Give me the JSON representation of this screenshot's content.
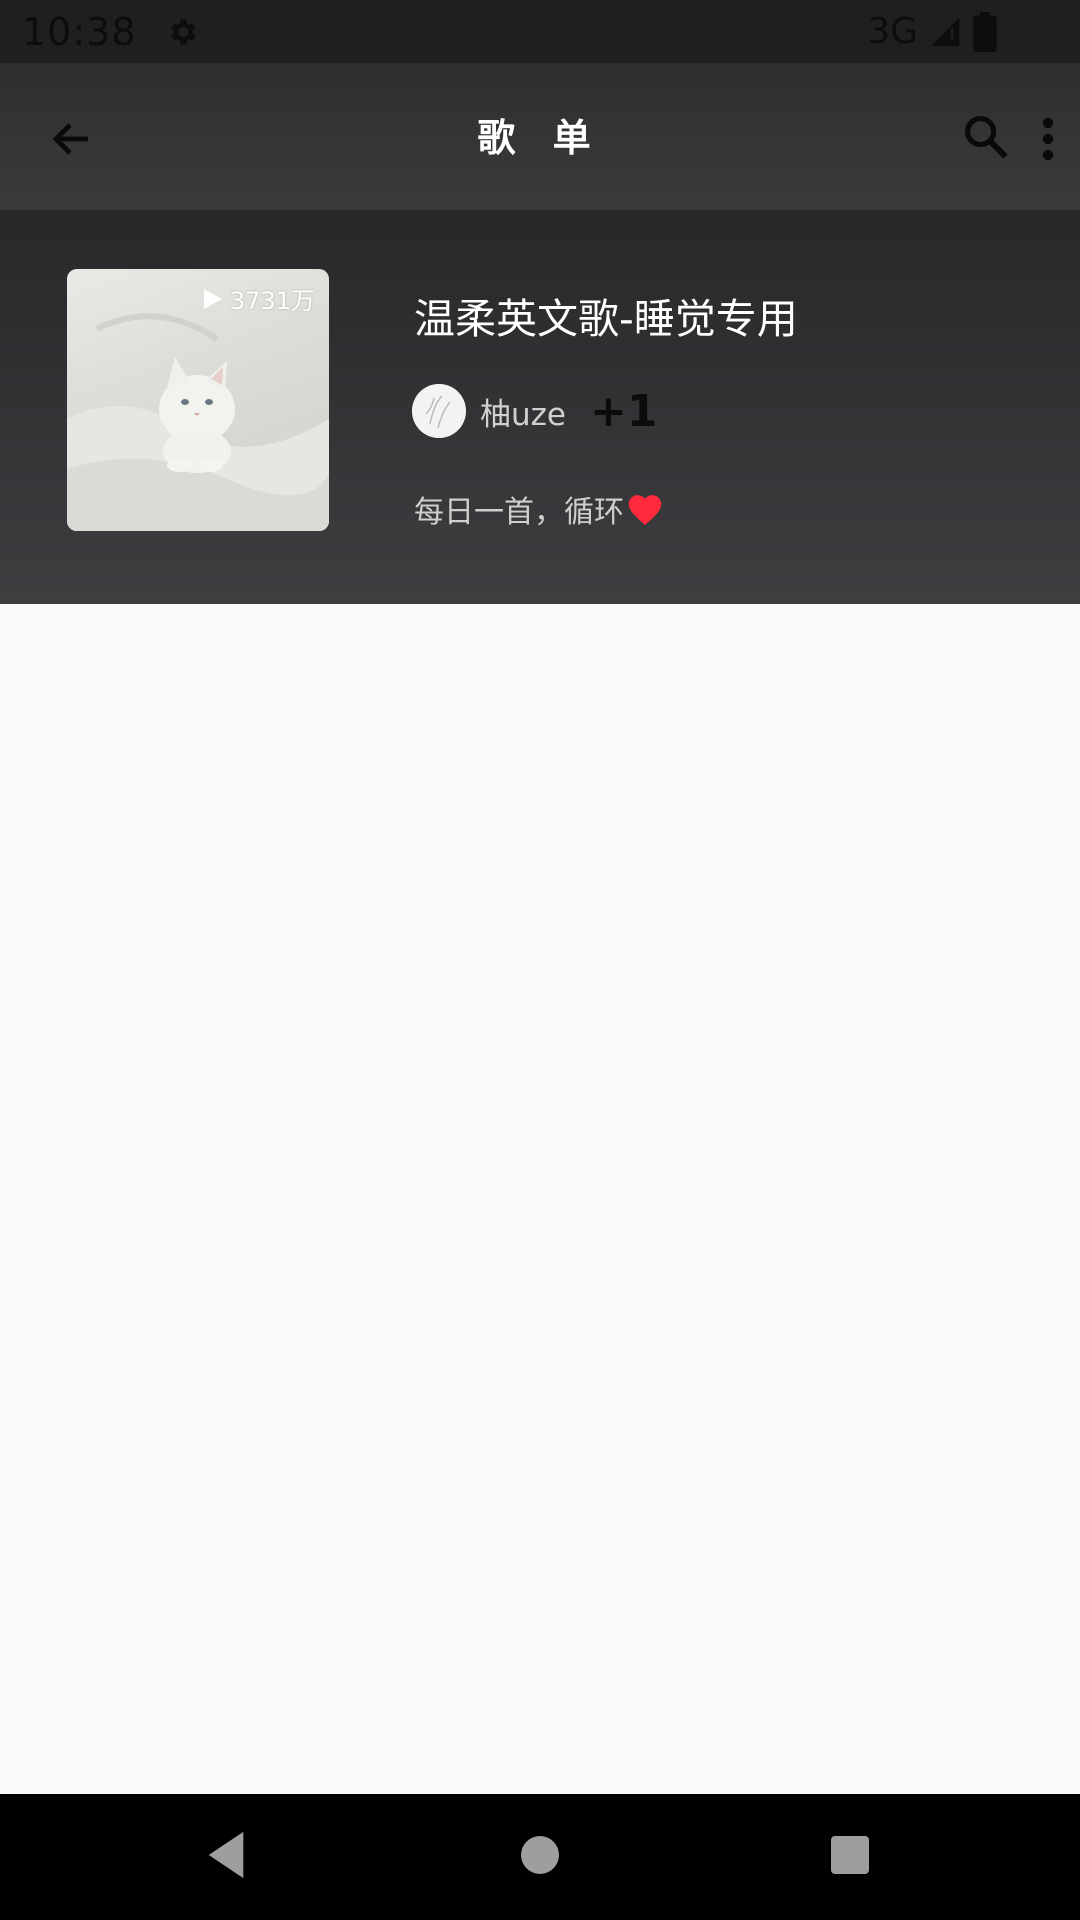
{
  "status_bar": {
    "time": "10:38",
    "network": "3G",
    "icons": [
      "settings-gear-icon",
      "signal-icon",
      "battery-icon"
    ]
  },
  "app_bar": {
    "title": "歌 单",
    "icons": [
      "back-arrow-icon",
      "search-icon",
      "more-vert-icon"
    ]
  },
  "playlist": {
    "play_count": "3731万",
    "title": "温柔英文歌-睡觉专用",
    "creator_name": "柚uze",
    "extra_creators": "+1",
    "description": "每日一首，循环"
  },
  "colors": {
    "header_dark": "#2d2e30",
    "heart": "#ff2a3c",
    "background": "#fafafa"
  },
  "nav_bar": {
    "icons": [
      "nav-back-icon",
      "nav-home-icon",
      "nav-recents-icon"
    ]
  }
}
